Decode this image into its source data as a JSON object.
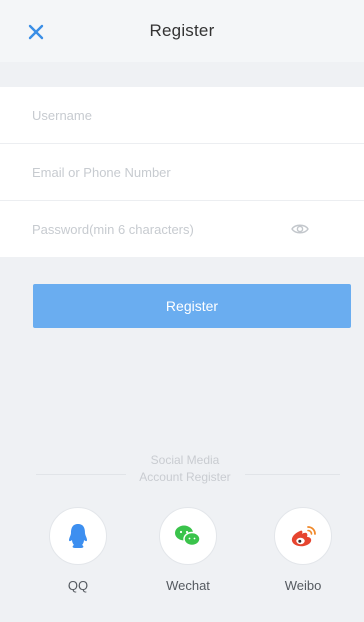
{
  "header": {
    "title": "Register",
    "close_icon": "close-icon",
    "accent_color": "#3a8ee6"
  },
  "form": {
    "username_placeholder": "Username",
    "email_placeholder": "Email or Phone Number",
    "password_placeholder": "Password(min 6 characters)",
    "password_toggle_icon": "eye-icon"
  },
  "register_button": {
    "label": "Register",
    "color": "#6aadf0"
  },
  "social": {
    "heading_line1": "Social Media",
    "heading_line2": "Account Register",
    "items": [
      {
        "label": "QQ",
        "icon": "qq-icon",
        "color": "#3d8ff0"
      },
      {
        "label": "Wechat",
        "icon": "wechat-icon",
        "color": "#3ac34b"
      },
      {
        "label": "Weibo",
        "icon": "weibo-icon",
        "color": "#e6452f"
      }
    ]
  }
}
